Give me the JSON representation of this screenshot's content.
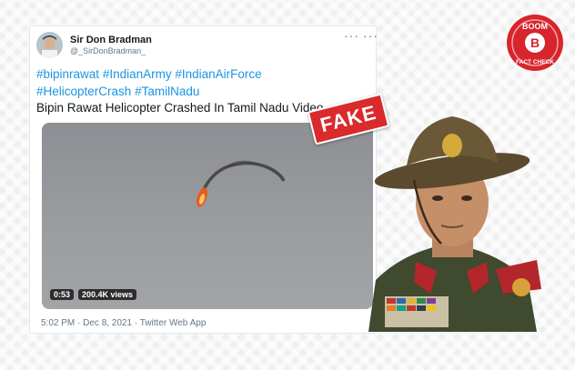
{
  "tweet": {
    "author_name": "Sir Don Bradman",
    "author_handle": "@_SirDonBradman_",
    "hashtags_line1": [
      "#bipinrawat",
      "#IndianArmy",
      "#IndianAirForce"
    ],
    "hashtags_line2": [
      "#HelicopterCrash",
      "#TamilNadu"
    ],
    "body": "Bipin Rawat Helicopter Crashed In Tamil Nadu Video.",
    "timestamp": "5:02 PM · Dec 8, 2021 · Twitter Web App"
  },
  "video": {
    "duration": "0:53",
    "views": "200.4K views"
  },
  "overlay": {
    "fake_label": "FAKE",
    "badge_top": "BOOM",
    "badge_letter": "B",
    "badge_bottom": "FACT CHECK"
  },
  "colors": {
    "hashtag": "#1b95e0",
    "fake": "#d92b2b",
    "badge": "#d8242c"
  },
  "icons": [
    "more-icon",
    "avatar-image",
    "boom-logo",
    "fake-stamp"
  ]
}
